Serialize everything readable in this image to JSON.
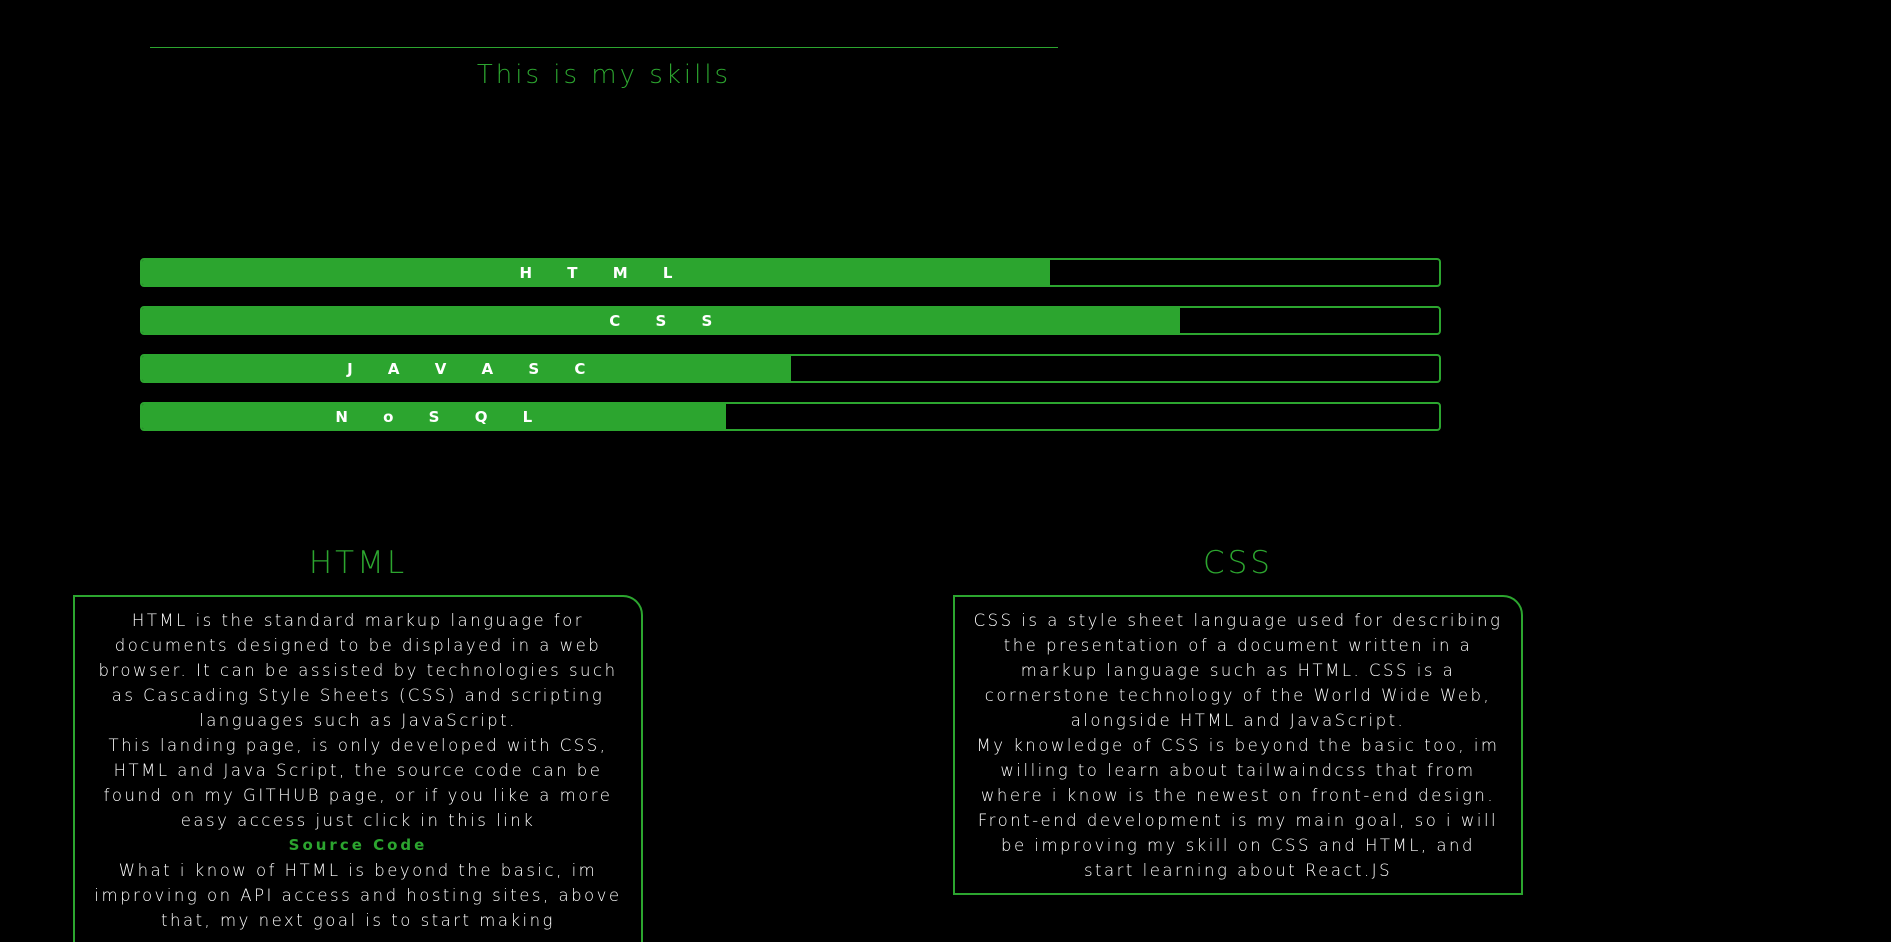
{
  "header": {
    "title": "This is my skills"
  },
  "colors": {
    "accent": "#2ca52f",
    "background": "#000000",
    "text": "#ffffff"
  },
  "skills": [
    {
      "label": "H T M L",
      "level": 70
    },
    {
      "label": "C S S",
      "level": 80
    },
    {
      "label": "J A V A S C",
      "level": 50
    },
    {
      "label": "N o S Q L",
      "level": 45
    }
  ],
  "cards": {
    "html": {
      "title": "HTML",
      "paragraph1": "HTML is the standard markup language for documents designed to be displayed in a web browser. It can be assisted by technologies such as Cascading Style Sheets (CSS) and scripting languages such as JavaScript.",
      "paragraph2": "This landing page, is only developed with CSS, HTML and Java Script, the source code can be found on my GITHUB page, or if you like a more easy access just click in this link",
      "link_label": "Source Code",
      "paragraph3": "What i know of HTML is beyond the basic, im improving on API access and hosting sites, above that, my next goal is to start making"
    },
    "css": {
      "title": "CSS",
      "paragraph1": "CSS is a style sheet language used for describing the presentation of a document written in a markup language such as HTML. CSS is a cornerstone technology of the World Wide Web, alongside HTML and JavaScript.",
      "paragraph2": "My knowledge of CSS is beyond the basic too, im willing to learn about tailwaindcss that from where i know is the newest on front-end design.",
      "paragraph3": "Front-end development is my main goal, so i will be improving my skill on CSS and HTML, and start learning about React.JS"
    }
  }
}
